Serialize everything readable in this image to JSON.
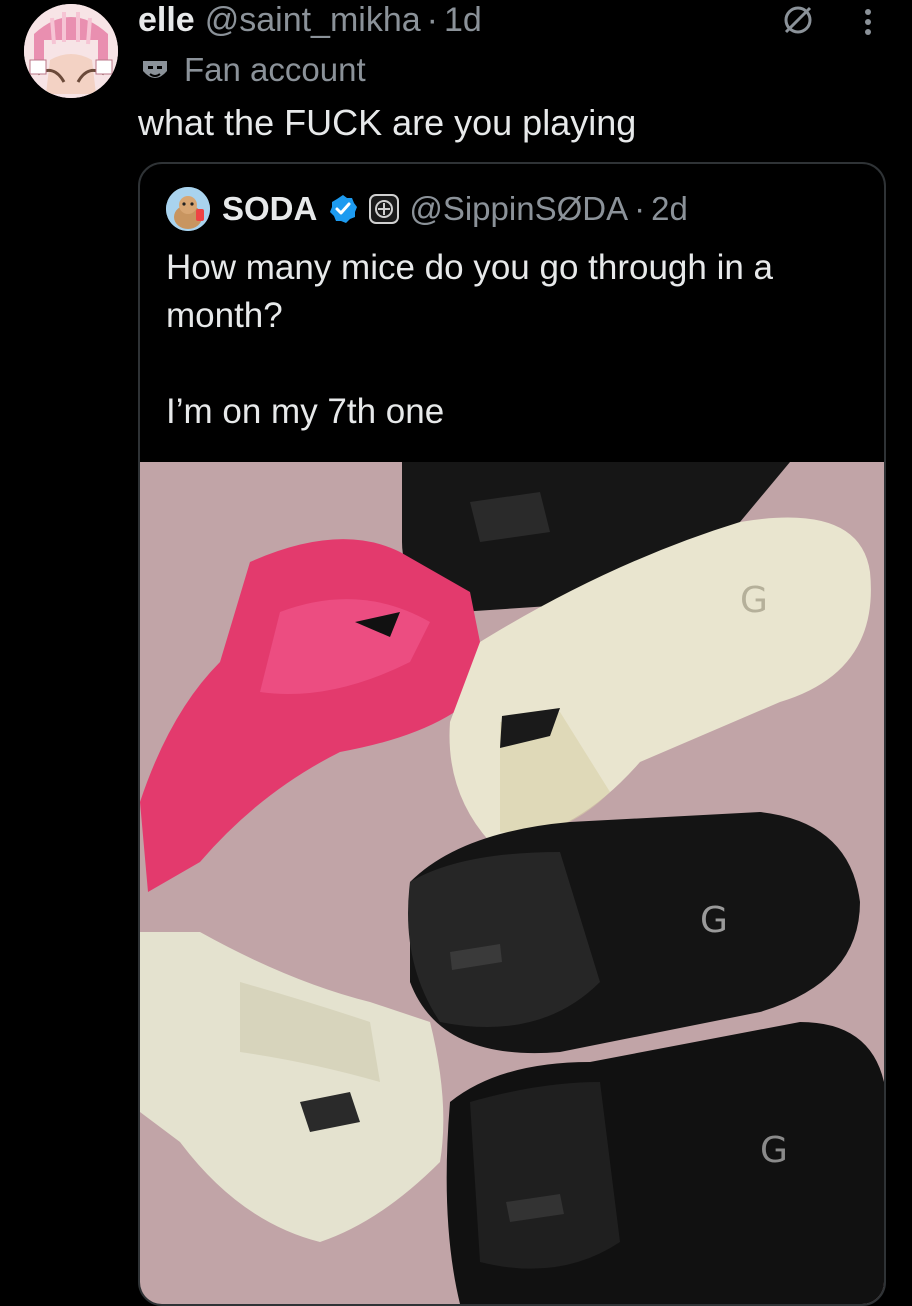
{
  "tweet": {
    "display_name": "elle",
    "handle": "@saint_mikha",
    "separator": "·",
    "time": "1d",
    "badge_label": "Fan account",
    "text": "what the FUCK are you playing",
    "icons": {
      "muted": "muted-icon",
      "more": "more-vertical-icon",
      "badge": "mask-icon"
    }
  },
  "quote": {
    "display_name": "SODA",
    "handle": "@SippinSØDA",
    "separator": "·",
    "time": "2d",
    "line1": "How many mice do you go through in a",
    "line2": "month?",
    "line3": "I’m on my 7th one",
    "icons": {
      "verified": "verified-badge-icon",
      "affiliate": "affiliate-badge-icon"
    }
  },
  "colors": {
    "background": "#000000",
    "text": "#e7e9ea",
    "secondary": "#8b9299",
    "verified": "#1d9bf0",
    "border": "#2f3336"
  }
}
